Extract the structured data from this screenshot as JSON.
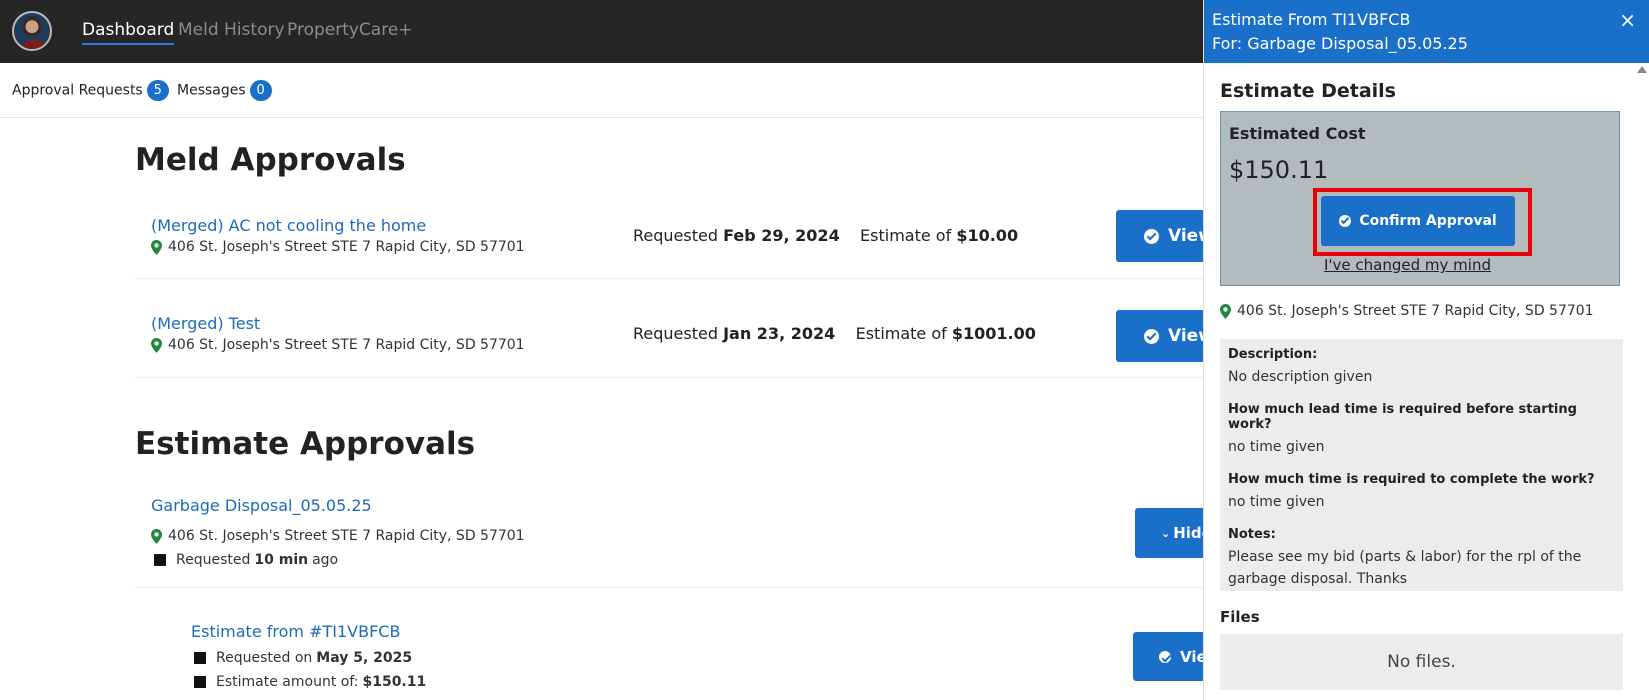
{
  "nav": {
    "items": [
      {
        "label": "Dashboard"
      },
      {
        "label": "Meld History"
      },
      {
        "label": "PropertyCare+"
      }
    ]
  },
  "subtabs": [
    {
      "label": "Approval Requests",
      "count": "5"
    },
    {
      "label": "Messages",
      "count": "0"
    }
  ],
  "meld_approvals": {
    "title": "Meld Approvals",
    "items": [
      {
        "title": "(Merged) AC not cooling the home",
        "address": "406 St. Joseph's Street STE 7 Rapid City, SD 57701",
        "requested_prefix": "Requested",
        "requested_date": "Feb 29, 2024",
        "estimate_prefix": "Estimate of",
        "estimate": "$10.00",
        "button": "View"
      },
      {
        "title": "(Merged) Test",
        "address": "406 St. Joseph's Street STE 7 Rapid City, SD 57701",
        "requested_prefix": "Requested",
        "requested_date": "Jan 23, 2024",
        "estimate_prefix": "Estimate of",
        "estimate": "$1001.00",
        "button": "View"
      }
    ]
  },
  "estimate_approvals": {
    "title": "Estimate Approvals",
    "item": {
      "title": "Garbage Disposal_05.05.25",
      "address": "406 St. Joseph's Street STE 7 Rapid City, SD 57701",
      "requested_prefix": "Requested",
      "requested_value": "10 min",
      "requested_suffix": "ago",
      "button": "Hide"
    },
    "sub": {
      "title": "Estimate from #TI1VBFCB",
      "requested_prefix": "Requested on",
      "requested_date": "May 5, 2025",
      "amount_prefix": "Estimate amount of:",
      "amount": "$150.11",
      "button": "View"
    }
  },
  "panel": {
    "title_line1": "Estimate From TI1VBFCB",
    "title_line2": "For: Garbage Disposal_05.05.25",
    "close": "×",
    "details_title": "Estimate Details",
    "cost_label": "Estimated Cost",
    "cost_value": "$150.11",
    "confirm_button": "Confirm Approval",
    "changed_mind": "I've changed my mind",
    "address": "406 St. Joseph's Street STE 7 Rapid City, SD 57701",
    "info": [
      {
        "q": "Description:",
        "a": "No description given"
      },
      {
        "q": "How much lead time is required before starting work?",
        "a": "no time given"
      },
      {
        "q": "How much time is required to complete the work?",
        "a": "no time given"
      },
      {
        "q": "Notes:",
        "a": "Please see my bid (parts & labor) for the rpl of the garbage disposal. Thanks"
      }
    ],
    "files_title": "Files",
    "files_empty": "No files."
  },
  "colors": {
    "accent": "#1a6fc9",
    "topbar": "#262626",
    "highlight": "#e8000b",
    "pin": "#1e8a3c"
  }
}
